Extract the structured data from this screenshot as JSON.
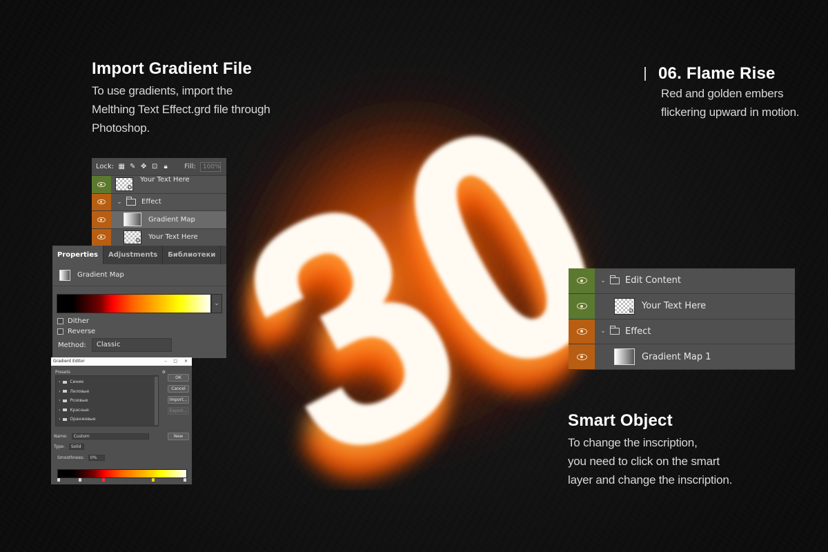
{
  "colors": {
    "background": "#141414",
    "panel_gray": "#535353",
    "layer_green": "#5b7a30",
    "layer_orange": "#b85e12",
    "flame_core": "#ffffff",
    "flame_glow": "#ff6a00"
  },
  "import_section": {
    "title": "Import Gradient File",
    "desc_lines": [
      "To use gradients, import the",
      "Melthing Text Effect.grd file through",
      "Photoshop."
    ]
  },
  "flame_section": {
    "title": "06. Flame Rise",
    "desc_lines": [
      "Red and golden embers",
      "flickering upward in motion."
    ]
  },
  "smart_section": {
    "title": "Smart Object",
    "desc_lines": [
      "To change the inscription,",
      "you need to click on the smart",
      " layer and change the inscription."
    ]
  },
  "layers_small": {
    "lock_label": "Lock:",
    "lock_icons": [
      "checkerboard-lock-icon",
      "brush-lock-icon",
      "move-lock-icon",
      "artboard-lock-icon",
      "padlock-icon"
    ],
    "fill_label": "Fill:",
    "fill_value": "100%",
    "rows": [
      {
        "label": "Your Text Here",
        "type": "smart",
        "color": "#5b7a30",
        "indent": false,
        "partial": true
      },
      {
        "label": "Effect",
        "type": "group",
        "color": "#b85e12",
        "indent": false
      },
      {
        "label": "Gradient Map",
        "type": "adjust",
        "color": "#b85e12",
        "indent": true,
        "selected": true
      },
      {
        "label": "Your Text Here",
        "type": "smart",
        "color": "#b85e12",
        "indent": true
      }
    ]
  },
  "properties": {
    "tabs": [
      "Properties",
      "Adjustments",
      "Библиотеки"
    ],
    "active_tab": 0,
    "adjustment_name": "Gradient Map",
    "dither_label": "Dither",
    "reverse_label": "Reverse",
    "method_label": "Method:",
    "method_value": "Classic"
  },
  "gradient_editor": {
    "title": "Gradient Editor",
    "presets_label": "Presets",
    "gear": "⚙",
    "folders": [
      "Синие",
      "Лиловые",
      "Розовые",
      "Красные",
      "Оранжевые"
    ],
    "buttons": {
      "ok": "OK",
      "cancel": "Cancel",
      "import": "Import...",
      "export": "Export...",
      "new": "New"
    },
    "name_label": "Name:",
    "name_value": "Custom",
    "type_label": "Type:",
    "type_value": "Solid",
    "smoothness_label": "Smoothness:",
    "smoothness_value": "0%"
  },
  "layers_right": {
    "rows": [
      {
        "label": "Edit Content",
        "type": "group",
        "color": "#5b7a30",
        "indent": false
      },
      {
        "label": "Your Text Here",
        "type": "smart",
        "color": "#5b7a30",
        "indent": true
      },
      {
        "label": "Effect",
        "type": "group",
        "color": "#b85e12",
        "indent": false
      },
      {
        "label": "Gradient Map 1",
        "type": "adjust",
        "color": "#b85e12",
        "indent": true
      }
    ]
  },
  "flame_text": {
    "glyphs": "30"
  }
}
